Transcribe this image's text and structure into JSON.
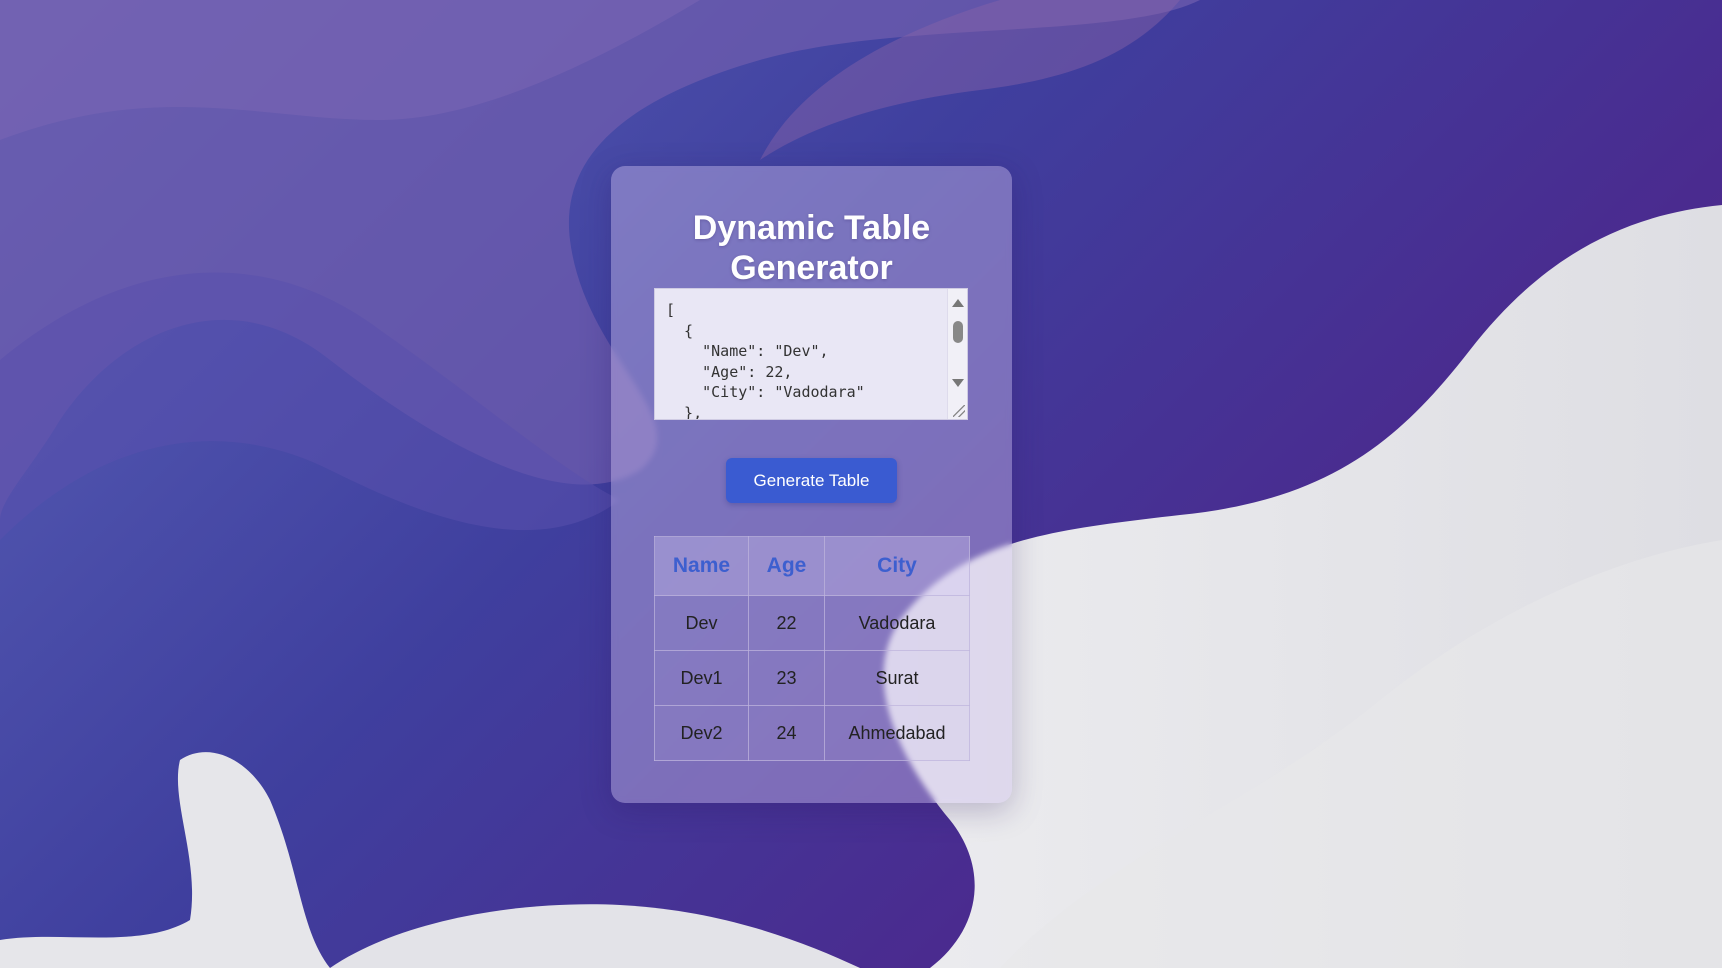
{
  "app": {
    "title_line1": "Dynamic Table",
    "title_line2": "Generator"
  },
  "json_input": {
    "value": "[\n  {\n    \"Name\": \"Dev\",\n    \"Age\": 22,\n    \"City\": \"Vadodara\"\n  },"
  },
  "actions": {
    "generate_label": "Generate Table"
  },
  "table": {
    "headers": [
      "Name",
      "Age",
      "City"
    ],
    "rows": [
      [
        "Dev",
        "22",
        "Vadodara"
      ],
      [
        "Dev1",
        "23",
        "Surat"
      ],
      [
        "Dev2",
        "24",
        "Ahmedabad"
      ]
    ]
  },
  "icons": {
    "scroll_up": "chevron-up-icon",
    "scroll_down": "chevron-down-icon",
    "resize": "resize-grip-icon"
  },
  "colors": {
    "button": "#3a5bd1",
    "header_text": "#3d5fcf",
    "title_text": "#ffffff"
  }
}
